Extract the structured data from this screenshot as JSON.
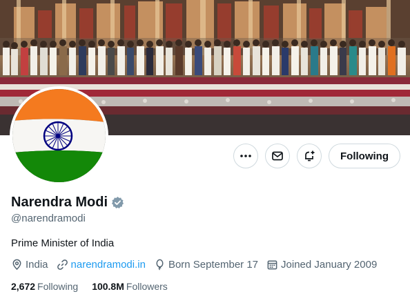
{
  "profile": {
    "name": "Narendra Modi",
    "handle": "@narendramodi",
    "bio": "Prime Minister of India",
    "verified": true
  },
  "actions": {
    "more_icon": "more-horizontal-icon",
    "message_icon": "mail-icon",
    "notify_icon": "bell-plus-icon",
    "follow_label": "Following"
  },
  "meta": {
    "location": "India",
    "website": "narendramodi.in",
    "birthday": "Born September 17",
    "joined": "Joined January 2009"
  },
  "stats": {
    "following_count": "2,672",
    "following_label": "Following",
    "followers_count": "100.8M",
    "followers_label": "Followers"
  },
  "colors": {
    "accent": "#1d9bf0",
    "verified_badge": "#829aab",
    "flag_saffron": "#f47a1f",
    "flag_white": "#ffffff",
    "flag_green": "#138808",
    "chakra_blue": "#000080"
  }
}
